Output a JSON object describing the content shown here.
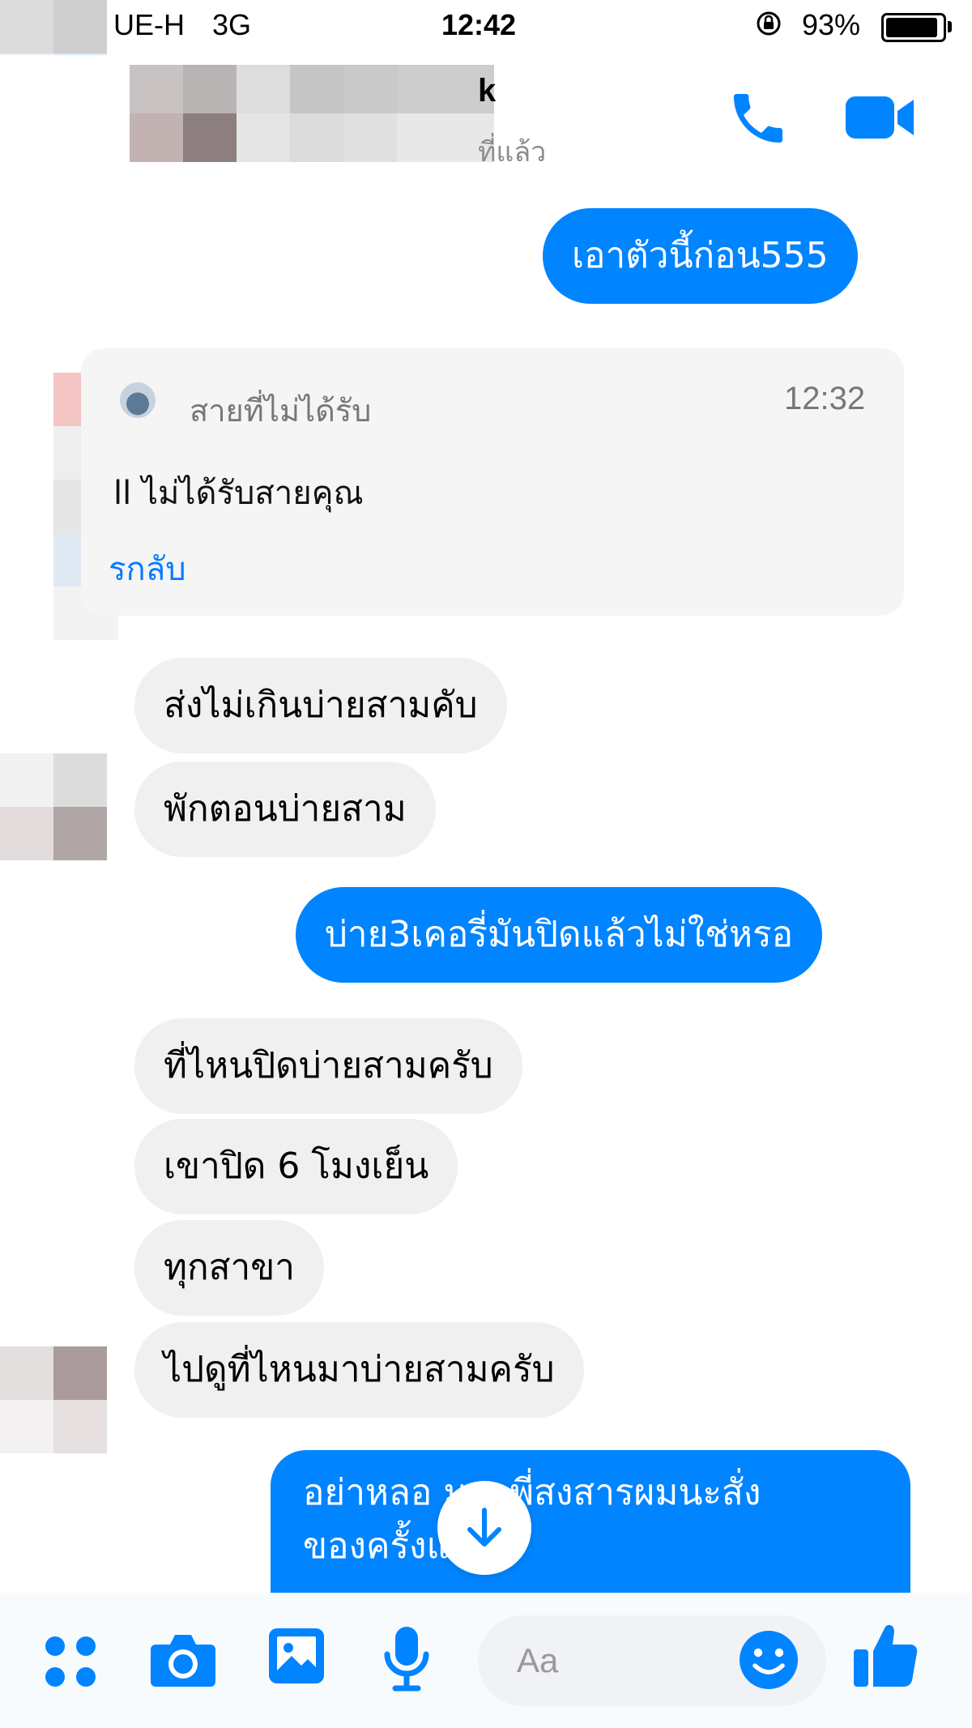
{
  "status_bar": {
    "carrier": "UE-H",
    "network": "3G",
    "time": "12:42",
    "battery_percent": "93%",
    "battery_level": 0.93
  },
  "header": {
    "contact_name": "k",
    "contact_status": "ที่แล้ว",
    "icons": [
      "phone-icon",
      "video-camera-icon"
    ]
  },
  "messages": {
    "m1": "เอาตัวนี้ก่อน555",
    "m2": "ส่งไม่เกินบ่ายสามคับ",
    "m3": "พักตอนบ่ายสาม",
    "m4": "บ่าย3เคอรี่มันปิดแล้วไม่ใช่หรอ",
    "m5": "ที่ไหนปิดบ่ายสามครับ",
    "m6": "เขาปิด 6 โมงเย็น",
    "m7": "ทุกสาขา",
    "m8": "ไปดูที่ไหนมาบ่ายสามครับ",
    "m9_line1": "อย่าหลอ      มนะพี่สงสารผมนะสั่ง",
    "m9_line2": "ของครั้งแรก"
  },
  "missed_call": {
    "title": "สายที่ไม่ได้รับ",
    "time": "12:32",
    "message": "ll ไม่ได้รับสายคุณ",
    "action": "รกลับ"
  },
  "composer": {
    "placeholder": "Aa",
    "icons": [
      "apps-icon",
      "camera-icon",
      "gallery-icon",
      "microphone-icon",
      "emoji-icon",
      "thumbs-up-icon"
    ]
  },
  "colors": {
    "accent": "#0084ff",
    "incoming_bubble": "#f0f0f0",
    "outgoing_text": "#ffffff",
    "call_card": "#f5f5f5"
  }
}
